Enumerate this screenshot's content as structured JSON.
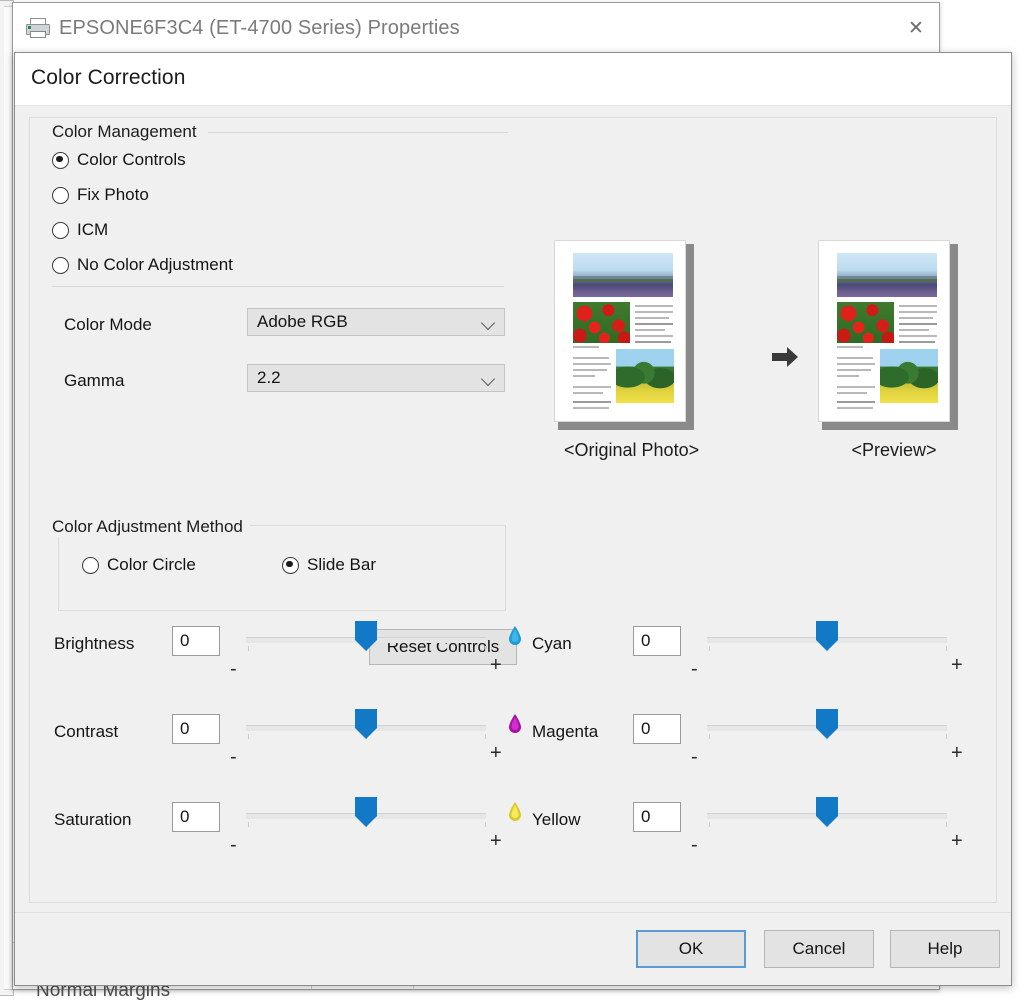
{
  "background_window": {
    "title": "EPSONE6F3C4 (ET-4700 Series) Properties",
    "close_label": "✕",
    "printer_icon": "printer-icon",
    "bottom_text": "Normal Margins"
  },
  "dialog": {
    "title": "Color Correction",
    "color_management": {
      "group_label": "Color Management",
      "options": [
        {
          "label": "Color Controls",
          "selected": true
        },
        {
          "label": "Fix Photo",
          "selected": false
        },
        {
          "label": "ICM",
          "selected": false
        },
        {
          "label": "No Color Adjustment",
          "selected": false
        }
      ]
    },
    "fields": [
      {
        "label": "Color Mode",
        "value": "Adobe RGB"
      },
      {
        "label": "Gamma",
        "value": "2.2"
      }
    ],
    "color_adjustment_method": {
      "group_label": "Color Adjustment Method",
      "options": [
        {
          "label": "Color Circle",
          "selected": false
        },
        {
          "label": "Slide Bar",
          "selected": true
        }
      ]
    },
    "reset_button": "Reset Controls",
    "preview": {
      "original_caption": "<Original Photo>",
      "preview_caption": "<Preview>",
      "arrow_icon": "right-arrow-icon"
    },
    "sliders_left": [
      {
        "label": "Brightness",
        "value": "0",
        "minus": "-",
        "plus": "+",
        "position_pct": 50
      },
      {
        "label": "Contrast",
        "value": "0",
        "minus": "-",
        "plus": "+",
        "position_pct": 50
      },
      {
        "label": "Saturation",
        "value": "0",
        "minus": "-",
        "plus": "+",
        "position_pct": 50
      }
    ],
    "sliders_right": [
      {
        "label": "Cyan",
        "value": "0",
        "minus": "-",
        "plus": "+",
        "position_pct": 50,
        "icon": "cyan-ink-drop-icon",
        "color": "#1b9ad6"
      },
      {
        "label": "Magenta",
        "value": "0",
        "minus": "-",
        "plus": "+",
        "position_pct": 50,
        "icon": "magenta-ink-drop-icon",
        "color": "#c21fc2"
      },
      {
        "label": "Yellow",
        "value": "0",
        "minus": "-",
        "plus": "+",
        "position_pct": 50,
        "icon": "yellow-ink-drop-icon",
        "color": "#ece03a"
      }
    ],
    "footer_buttons": [
      {
        "label": "OK",
        "default": true
      },
      {
        "label": "Cancel",
        "default": false
      },
      {
        "label": "Help",
        "default": false
      }
    ]
  },
  "colors": {
    "accent_blue": "#1279c6",
    "focus_blue": "#5b9bd5",
    "dialog_bg": "#f0f0f0",
    "header_bg": "#ffffff"
  }
}
